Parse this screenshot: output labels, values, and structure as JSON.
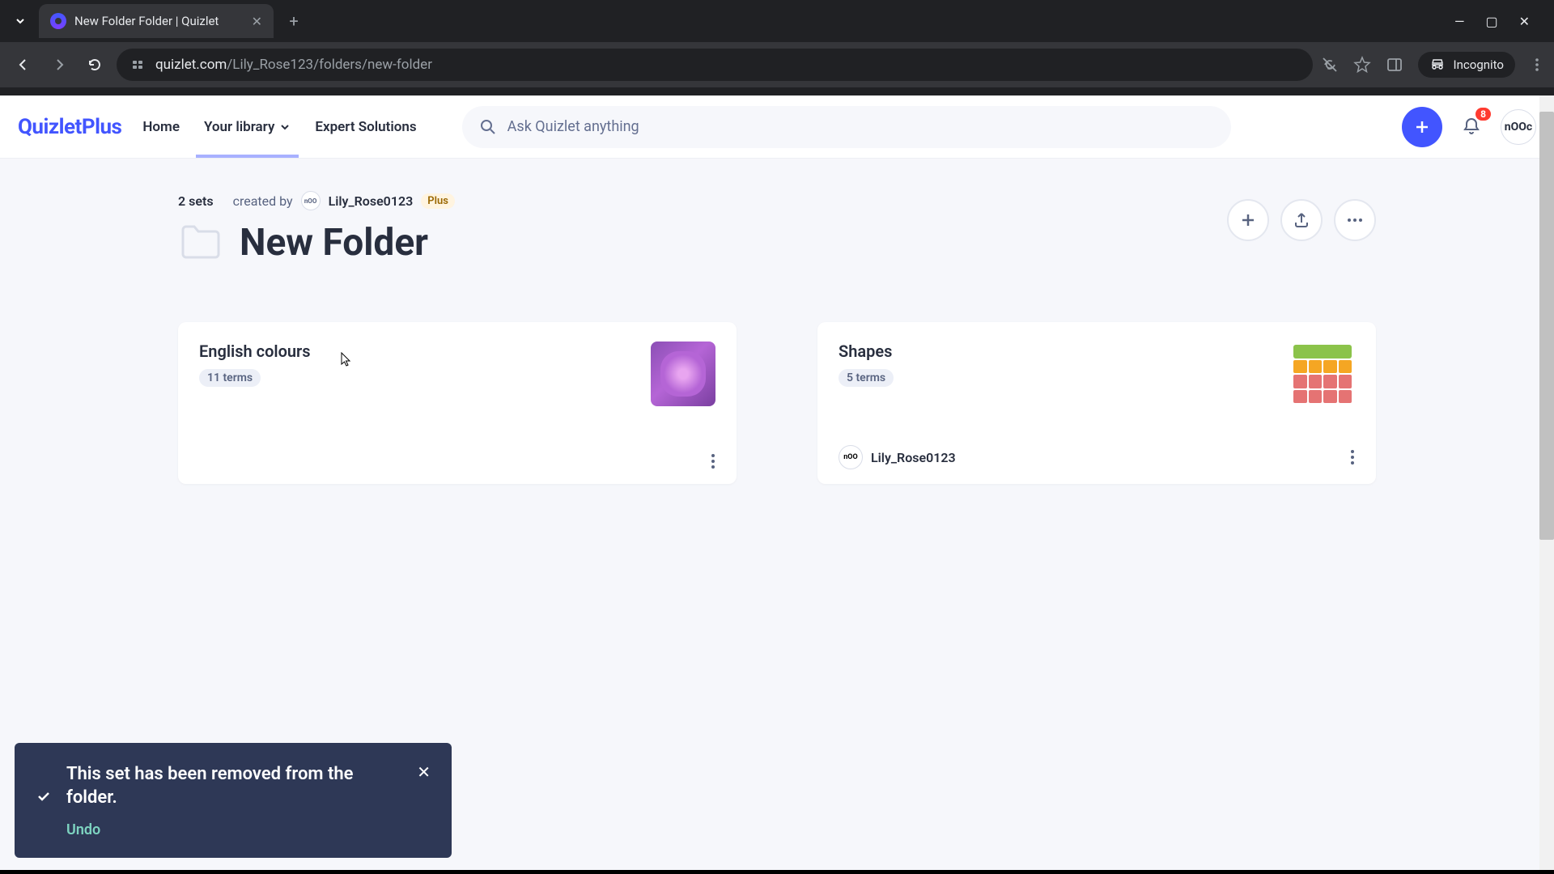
{
  "browser": {
    "tab_title": "New Folder Folder | Quizlet",
    "url_host": "quizlet.com",
    "url_path": "/Lily_Rose123/folders/new-folder",
    "incognito_label": "Incognito"
  },
  "header": {
    "logo_main": "Quizlet",
    "logo_suffix": "Plus",
    "nav": {
      "home": "Home",
      "library": "Your library",
      "expert": "Expert Solutions"
    },
    "search_placeholder": "Ask Quizlet anything",
    "notif_count": "8",
    "avatar_text": "nOOc"
  },
  "folder": {
    "set_count": "2 sets",
    "created_by_label": "created by",
    "creator_avatar_text": "nOO",
    "creator_name": "Lily_Rose0123",
    "plus_tag": "Plus",
    "title": "New Folder"
  },
  "cards": [
    {
      "title": "English colours",
      "terms": "11 terms",
      "thumb_type": "flower",
      "author": null
    },
    {
      "title": "Shapes",
      "terms": "5 terms",
      "thumb_type": "shapes",
      "author": "Lily_Rose0123",
      "author_avatar_text": "nOO"
    }
  ],
  "toast": {
    "message": "This set has been removed from the folder.",
    "undo": "Undo"
  }
}
